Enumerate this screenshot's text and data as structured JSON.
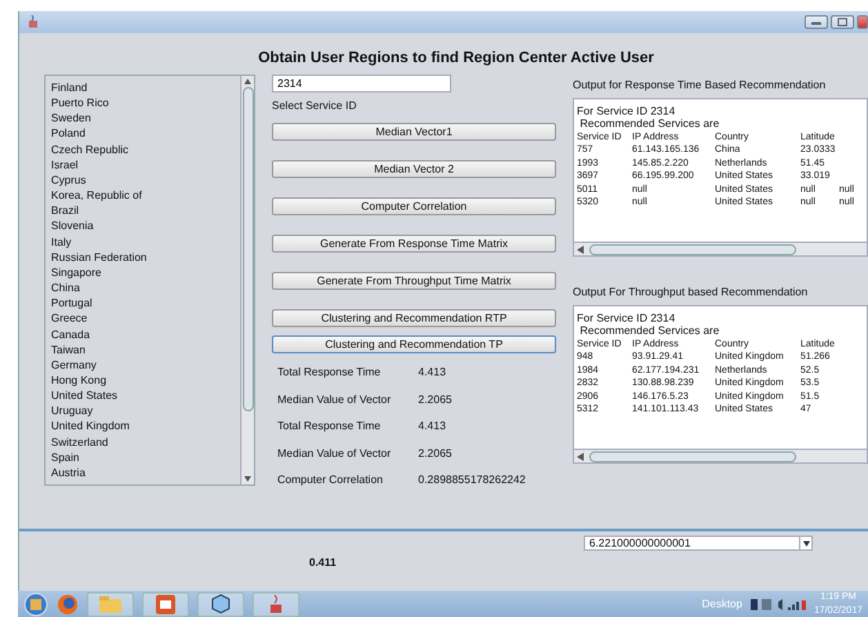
{
  "window": {
    "title": "Obtain User Regions to find Region Center Active User"
  },
  "regions": [
    "Finland",
    "Puerto Rico",
    "Sweden",
    "Poland",
    "Czech Republic",
    "Israel",
    "Cyprus",
    "Korea, Republic of",
    "Brazil",
    "Slovenia",
    "Italy",
    "Russian Federation",
    "Singapore",
    "China",
    "Portugal",
    "Greece",
    "Canada",
    "Taiwan",
    "Germany",
    "Hong Kong",
    "United States",
    "Uruguay",
    "United Kingdom",
    "Switzerland",
    "Spain",
    "Austria"
  ],
  "service_field": {
    "value": "2314",
    "label": "Select Service ID"
  },
  "buttons": [
    {
      "label": "Median Vector1",
      "focused": false
    },
    {
      "label": "Median Vector 2",
      "focused": false
    },
    {
      "label": "Computer Correlation",
      "focused": false
    },
    {
      "label": "Generate From Response Time Matrix",
      "focused": false
    },
    {
      "label": "Generate From Throughput Time Matrix",
      "focused": false
    },
    {
      "label": "Clustering and Recommendation RTP",
      "focused": false
    },
    {
      "label": "Clustering and Recommendation TP",
      "focused": true
    }
  ],
  "results": [
    {
      "label": "Total Response Time",
      "value": "4.413"
    },
    {
      "label": "Median Value of Vector",
      "value": "2.2065"
    },
    {
      "label": "Total Response Time",
      "value": "4.413"
    },
    {
      "label": "Median Value of Vector",
      "value": "2.2065"
    },
    {
      "label": "Computer Correlation",
      "value": "0.2898855178262242"
    }
  ],
  "outputs": [
    {
      "title": "Output for Response Time Based Recommendation",
      "lines": [
        "For Service ID 2314",
        " Recommended Services are"
      ],
      "header": [
        "Service ID",
        "IP Address",
        "Country",
        "Latitude"
      ],
      "rows": [
        [
          "757",
          "61.143.165.136",
          "China",
          "23.0333"
        ],
        [
          "1993",
          "145.85.2.220",
          "Netherlands",
          "51.45"
        ],
        [
          "3697",
          "66.195.99.200",
          "United States",
          "33.019"
        ],
        [
          "5011",
          "null",
          "United States",
          "null",
          "null"
        ],
        [
          "5320",
          "null",
          "United States",
          "null",
          "null"
        ]
      ]
    },
    {
      "title": "Output For Throughput based Recommendation",
      "lines": [
        "For Service ID 2314",
        " Recommended Services are"
      ],
      "header": [
        "Service ID",
        "IP Address",
        "Country",
        "Latitude"
      ],
      "rows": [
        [
          "948",
          "93.91.29.41",
          "United Kingdom",
          "51.266"
        ],
        [
          "1984",
          "62.177.194.231",
          "Netherlands",
          "52.5"
        ],
        [
          "2832",
          "130.88.98.239",
          "United Kingdom",
          "53.5"
        ],
        [
          "2906",
          "146.176.5.23",
          "United Kingdom",
          "51.5"
        ],
        [
          "5312",
          "141.101.113.43",
          "United States",
          "47"
        ]
      ]
    }
  ],
  "combo": {
    "value": "6.221000000000001"
  },
  "bottom_value": "0.411",
  "taskbar": {
    "desktop": "Desktop",
    "time": "1:19 PM",
    "date": "17/02/2017"
  }
}
